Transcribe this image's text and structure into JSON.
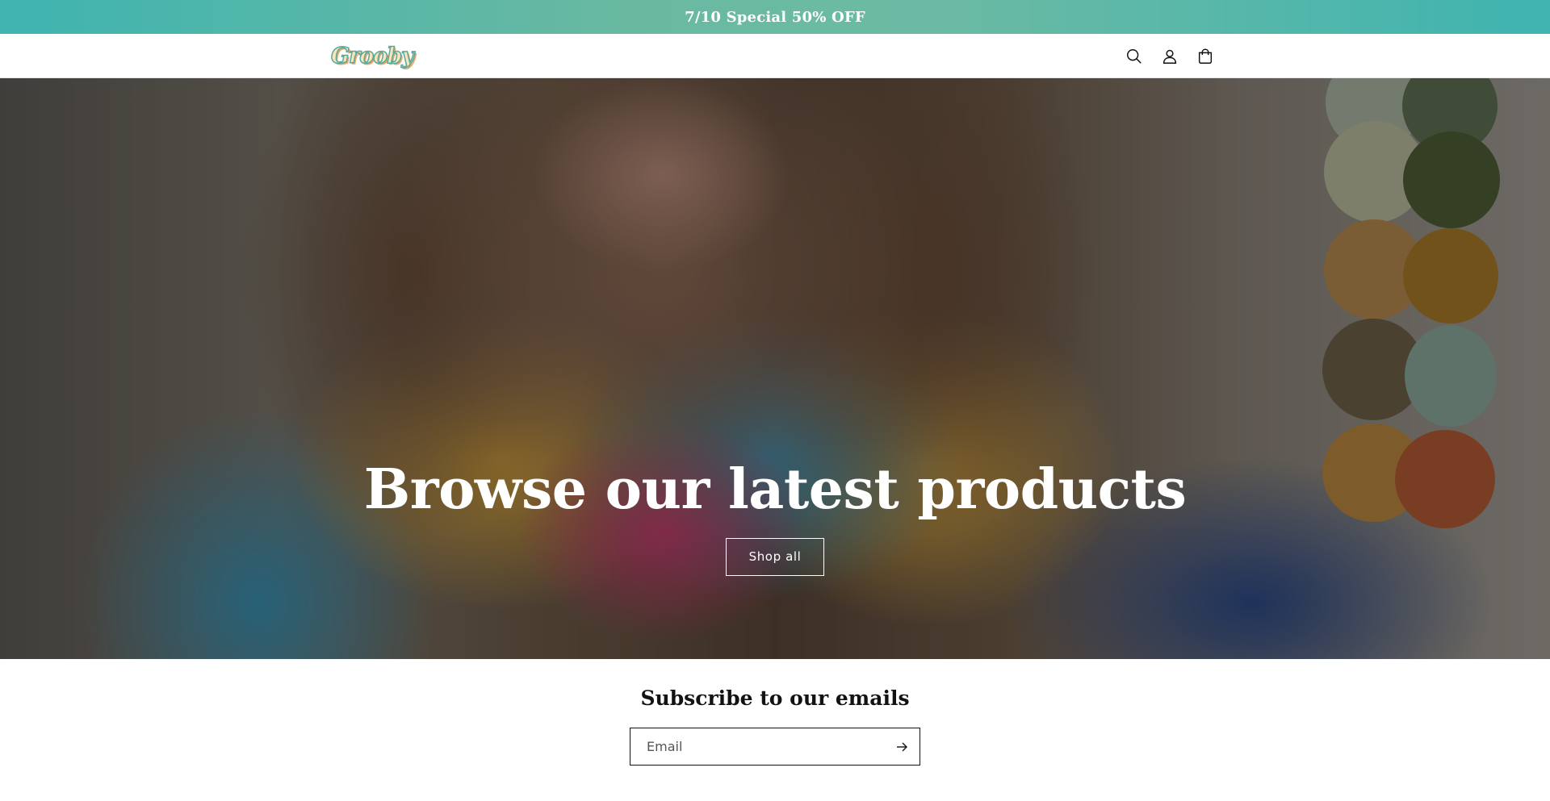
{
  "announcement": {
    "text": "7/10 Special 50% OFF"
  },
  "header": {
    "logo_text": "Grooby",
    "icons": [
      "search-icon",
      "account-icon",
      "cart-icon"
    ]
  },
  "hero": {
    "title": "Browse our latest products",
    "button_label": "Shop all"
  },
  "newsletter": {
    "title": "Subscribe to our emails",
    "email_placeholder": "Email",
    "submit_icon": "arrow-right-icon"
  },
  "colors": {
    "announcement_bg": "#5fb7a6",
    "text": "#121212",
    "white": "#ffffff"
  }
}
